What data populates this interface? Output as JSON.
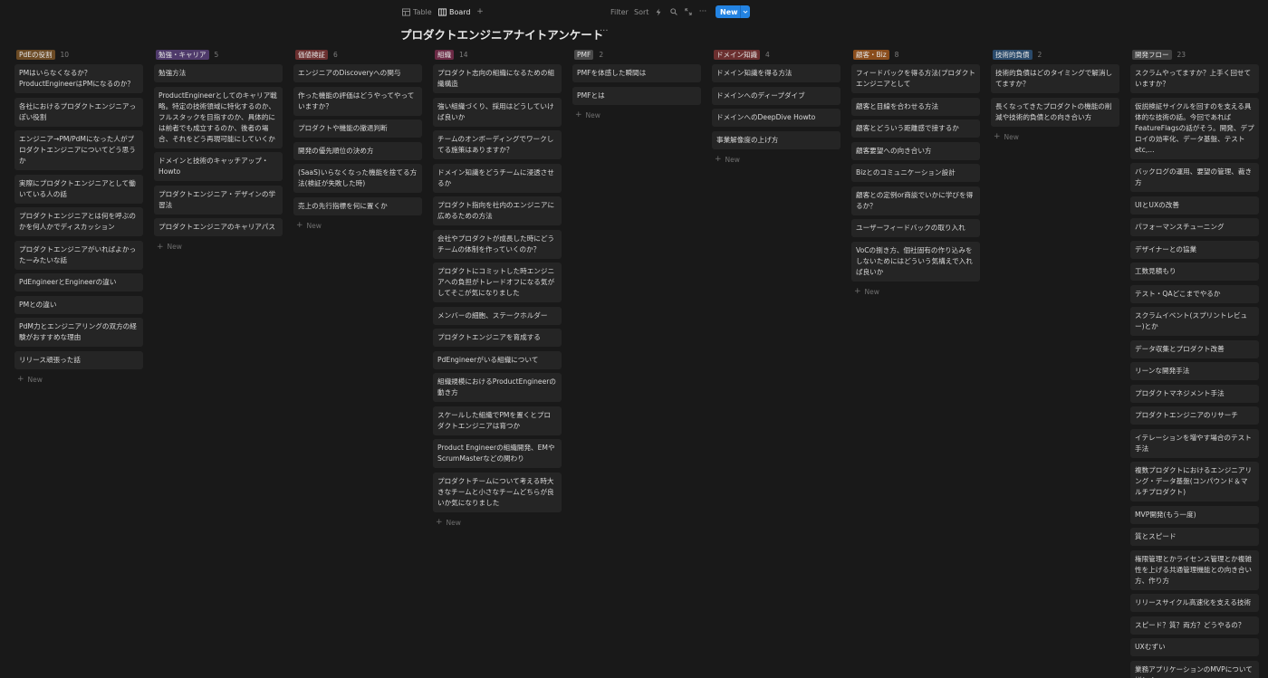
{
  "toolbar": {
    "tab_table": "Table",
    "tab_board": "Board",
    "add_view": "+",
    "filter": "Filter",
    "sort": "Sort",
    "more": "···",
    "new_label": "New"
  },
  "page": {
    "title": "プロダクトエンジニアナイトアンケート",
    "more": "···"
  },
  "add_new_label": "New",
  "columns": [
    {
      "label": "PdEの役割",
      "count": "10",
      "color": "#6b4a24",
      "cards": [
        "PMはいらなくなるか？ProductEngineerはPMになるのか？",
        "各社におけるプロダクトエンジニアっぽい役割",
        "エンジニア→PM/PdMになった人がプロダクトエンジニアについてどう思うか",
        "実際にプロダクトエンジニアとして働いている人の話",
        "プロダクトエンジニアとは何を呼ぶのかを何人かでディスカッション",
        "プロダクトエンジニアがいればよかったーみたいな話",
        "PdEngineerとEngineerの違い",
        "PMとの違い",
        "PdM力とエンジニアリングの双方の経験がおすすめな理由",
        "リリース頑張った話"
      ]
    },
    {
      "label": "勉強・キャリア",
      "count": "5",
      "color": "#4f3a6b",
      "cards": [
        "勉強方法",
        "ProductEngineerとしてのキャリア戦略。特定の技術領域に特化するのか、フルスタックを目指すのか、具体的には前者でも成立するのか、後者の場合、それをどう再現可能にしていくか",
        "ドメインと技術のキャッチアップ・Howto",
        "プロダクトエンジニア・デザインの学習法",
        "プロダクトエンジニアのキャリアパス"
      ]
    },
    {
      "label": "価値検証",
      "count": "6",
      "color": "#6b2f2f",
      "cards": [
        "エンジニアのDiscoveryへの関与",
        "作った機能の評価はどうやってやっていますか？",
        "プロダクトや機能の撤退判断",
        "開発の優先順位の決め方",
        "(SaaS)いらなくなった機能を捨てる方法(検証が失敗した時)",
        "売上の先行指標を何に置くか"
      ]
    },
    {
      "label": "組織",
      "count": "14",
      "color": "#6b2a45",
      "cards": [
        "プロダクト志向の組織になるための組織構造",
        "強い組織づくり、採用はどうしていけば良いか",
        "チームのオンボーディングでワークしてる施策はありますか？",
        "ドメイン知識をどうチームに浸透させるか",
        "プロダクト指向を社内のエンジニアに広めるための方法",
        "会社やプロダクトが成長した時にどうチームの体制を作っていくのか？",
        "プロダクトにコミットした時エンジニアへの負担がトレードオフになる気がしてそこが気になりました",
        "メンバーの細胞、ステークホルダー",
        "プロダクトエンジニアを育成する",
        "PdEngineerがいる組織について",
        "組織規模におけるProductEngineerの動き方",
        "スケールした組織でPMを置くとプロダクトエンジニアは育つか",
        "Product Engineerの組織開発、EMやScrumMasterなどの関わり",
        "プロダクトチームについて考える時大きなチームと小さなチームどちらが良いか気になりました"
      ]
    },
    {
      "label": "PMF",
      "count": "2",
      "color": "#4a4a4a",
      "cards": [
        "PMFを体感した瞬間は",
        "PMFとは"
      ]
    },
    {
      "label": "ドメイン知識",
      "count": "4",
      "color": "#6b2f2f",
      "cards": [
        "ドメイン知識を得る方法",
        "ドメインへのディープダイブ",
        "ドメインへのDeepDive Howto",
        "事業解像度の上げ方"
      ]
    },
    {
      "label": "顧客・Biz",
      "count": "8",
      "color": "#8a4d1c",
      "cards": [
        "フィードバックを得る方法(プロダクトエンジニアとして",
        "顧客と目線を合わせる方法",
        "顧客とどういう距離感で接するか",
        "顧客要望への向き合い方",
        "Bizとのコミュニケーション設計",
        "顧客との定例or商談でいかに学びを得るか？",
        "ユーザーフィードバックの取り入れ",
        "VoCの捌き方、個社固有の作り込みをしないためにはどういう気構えで入れば良いか"
      ]
    },
    {
      "label": "技術的負債",
      "count": "2",
      "color": "#2a4a6b",
      "cards": [
        "技術的負債はどのタイミングで解消してますか？",
        "長くなってきたプロダクトの機能の削減や技術的負債との向き合い方"
      ]
    },
    {
      "label": "開発フロー",
      "count": "23",
      "color": "#3f3f3f",
      "cards": [
        "スクラムやってますか？上手く回せていますか？",
        "仮説検証サイクルを回すのを支える具体的な技術の話。今回であればFeatureFlagsの話がそう。開発、デプロイの効率化、データ基盤、テストetc,...",
        "バックログの運用、要望の管理、裁き方",
        "UIとUXの改善",
        "パフォーマンスチューニング",
        "デザイナーとの協業",
        "工数見積もり",
        "テスト・QAどこまでやるか",
        "スクラムイベント(スプリントレビュー)とか",
        "データ収集とプロダクト改善",
        "リーンな開発手法",
        "プロダクトマネジメント手法",
        "プロダクトエンジニアのリサーチ",
        "イテレーションを増やす場合のテスト手法",
        "複数プロダクトにおけるエンジニアリング・データ基盤(コンパウンド＆マルチプロダクト)",
        "MVP開発(もう一度)",
        "質とスピード",
        "権限管理とかライセンス管理とか複雑性を上げる共通管理機能との向き合い方、作り方",
        "リリースサイクル高速化を支える技術",
        "スピード？質？両方？どうやるの？",
        "UXむずい",
        "業務アプリケーションのMVPについて詳しく"
      ]
    }
  ]
}
